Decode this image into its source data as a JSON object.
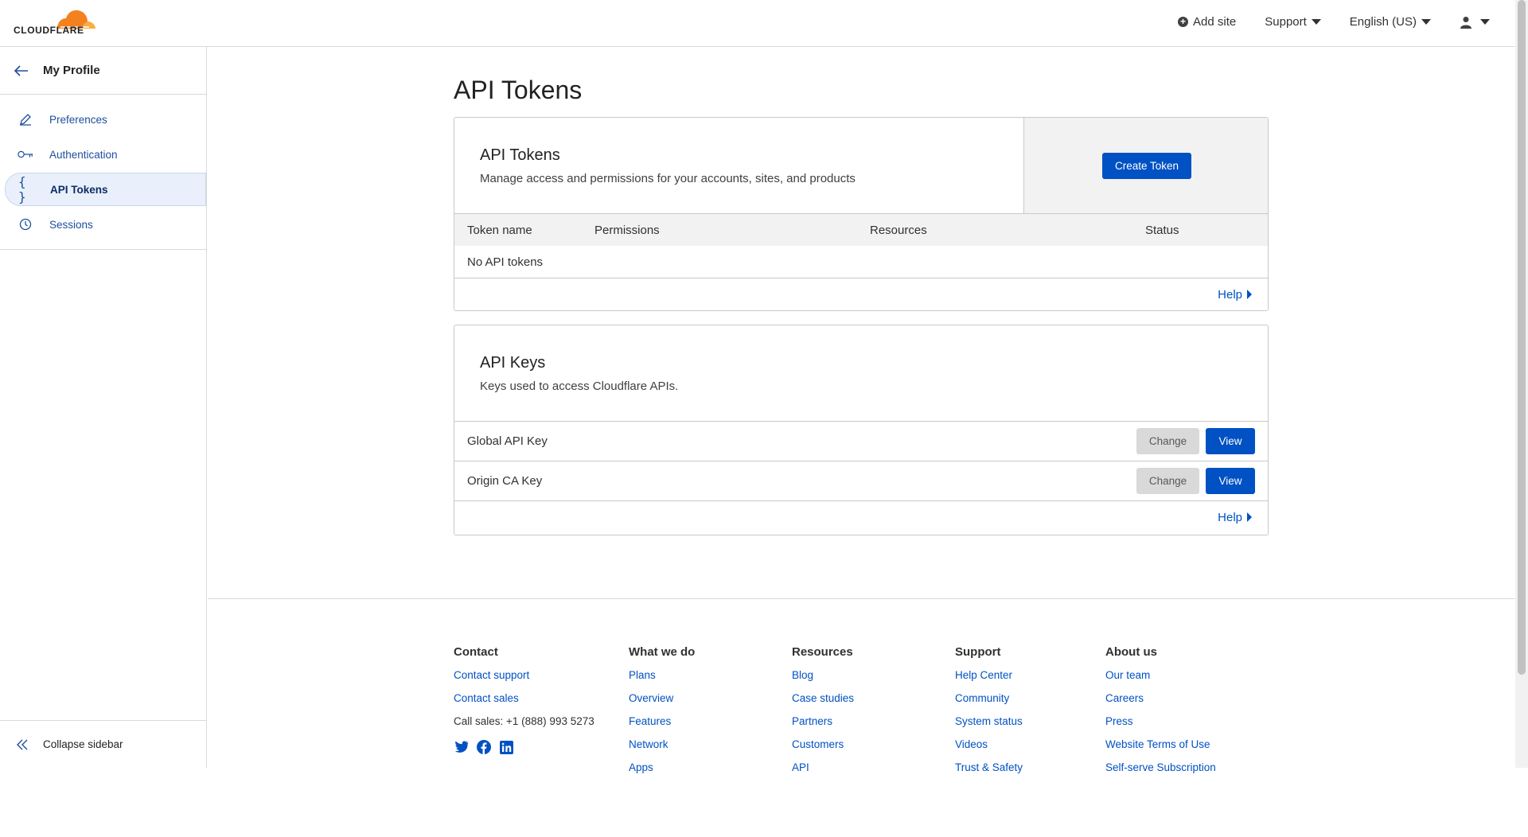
{
  "brand": {
    "name": "CLOUDFLARE",
    "accent": "#f48120",
    "primary": "#0051c3"
  },
  "topnav": {
    "add_site": "Add site",
    "support": "Support",
    "language": "English (US)",
    "account_icon": "user-icon"
  },
  "sidebar": {
    "header": "My Profile",
    "items": [
      {
        "label": "Preferences",
        "icon": "pencil-icon"
      },
      {
        "label": "Authentication",
        "icon": "key-icon"
      },
      {
        "label": "API Tokens",
        "icon": "braces-icon",
        "active": true
      },
      {
        "label": "Sessions",
        "icon": "clock-icon"
      }
    ],
    "collapse": "Collapse sidebar"
  },
  "page": {
    "title": "API Tokens"
  },
  "tokens_card": {
    "title": "API Tokens",
    "description": "Manage access and permissions for your accounts, sites, and products",
    "create_button": "Create Token",
    "columns": [
      "Token name",
      "Permissions",
      "Resources",
      "Status"
    ],
    "empty": "No API tokens",
    "help": "Help"
  },
  "keys_card": {
    "title": "API Keys",
    "description": "Keys used to access Cloudflare APIs.",
    "rows": [
      {
        "name": "Global API Key",
        "change": "Change",
        "view": "View"
      },
      {
        "name": "Origin CA Key",
        "change": "Change",
        "view": "View"
      }
    ],
    "help": "Help"
  },
  "footer": {
    "contact": {
      "heading": "Contact",
      "links": [
        "Contact support",
        "Contact sales"
      ],
      "phone": "Call sales: +1 (888) 993 5273"
    },
    "what_we_do": {
      "heading": "What we do",
      "links": [
        "Plans",
        "Overview",
        "Features",
        "Network",
        "Apps"
      ]
    },
    "resources": {
      "heading": "Resources",
      "links": [
        "Blog",
        "Case studies",
        "Partners",
        "Customers",
        "API"
      ]
    },
    "support": {
      "heading": "Support",
      "links": [
        "Help Center",
        "Community",
        "System status",
        "Videos",
        "Trust & Safety"
      ]
    },
    "about": {
      "heading": "About us",
      "links": [
        "Our team",
        "Careers",
        "Press",
        "Website Terms of Use",
        "Self-serve Subscription"
      ]
    }
  }
}
